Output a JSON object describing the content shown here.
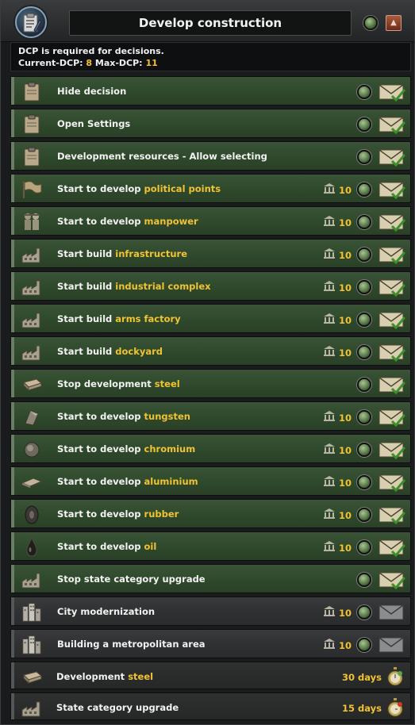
{
  "header": {
    "title": "Develop construction",
    "badge_icon": "decision-category-icon"
  },
  "info": {
    "line1": "DCP is required for decisions.",
    "current_label": "Current-DCP:",
    "current_value": "8",
    "max_label": "Max-DCP:",
    "max_value": "11"
  },
  "colors": {
    "highlight": "#f1c232",
    "row_green": "#2f4a2c",
    "row_gray": "#303132"
  },
  "rows": [
    {
      "prefix": "Hide decision",
      "highlight": "",
      "cost": "",
      "icon": "clipboard-icon",
      "style": "green",
      "state": "available"
    },
    {
      "prefix": "Open Settings",
      "highlight": "",
      "cost": "",
      "icon": "clipboard-icon",
      "style": "green",
      "state": "available"
    },
    {
      "prefix": "Development resources - Allow selecting",
      "highlight": "",
      "cost": "",
      "icon": "clipboard-icon",
      "style": "green",
      "state": "available"
    },
    {
      "prefix": "Start to develop ",
      "highlight": "political points",
      "cost": "10",
      "icon": "flag-icon",
      "style": "green",
      "state": "available"
    },
    {
      "prefix": "Start to develop ",
      "highlight": "manpower",
      "cost": "10",
      "icon": "soldiers-icon",
      "style": "green",
      "state": "available"
    },
    {
      "prefix": "Start build ",
      "highlight": "infrastructure",
      "cost": "10",
      "icon": "building-icon",
      "style": "green",
      "state": "available"
    },
    {
      "prefix": "Start build ",
      "highlight": "industrial complex",
      "cost": "10",
      "icon": "building-icon",
      "style": "green",
      "state": "available"
    },
    {
      "prefix": "Start build ",
      "highlight": "arms factory",
      "cost": "10",
      "icon": "building-icon",
      "style": "green",
      "state": "available"
    },
    {
      "prefix": "Start build ",
      "highlight": "dockyard",
      "cost": "10",
      "icon": "building-icon",
      "style": "green",
      "state": "available"
    },
    {
      "prefix": "Stop development ",
      "highlight": "steel",
      "cost": "",
      "icon": "steel-ingot-icon",
      "style": "green",
      "state": "available"
    },
    {
      "prefix": "Start to develop ",
      "highlight": "tungsten",
      "cost": "10",
      "icon": "tungsten-icon",
      "style": "green",
      "state": "available"
    },
    {
      "prefix": "Start to develop ",
      "highlight": "chromium",
      "cost": "10",
      "icon": "chromium-icon",
      "style": "green",
      "state": "available"
    },
    {
      "prefix": "Start to develop ",
      "highlight": "aluminium",
      "cost": "10",
      "icon": "aluminium-icon",
      "style": "green",
      "state": "available"
    },
    {
      "prefix": "Start to develop ",
      "highlight": "rubber",
      "cost": "10",
      "icon": "rubber-tire-icon",
      "style": "green",
      "state": "available"
    },
    {
      "prefix": "Start to develop ",
      "highlight": "oil",
      "cost": "10",
      "icon": "oil-drop-icon",
      "style": "green",
      "state": "available"
    },
    {
      "prefix": "Stop state category upgrade",
      "highlight": "",
      "cost": "",
      "icon": "building-icon",
      "style": "green",
      "state": "available"
    },
    {
      "prefix": "City modernization",
      "highlight": "",
      "cost": "10",
      "icon": "city-icon",
      "style": "gray",
      "state": "unavailable"
    },
    {
      "prefix": "Building a metropolitan area",
      "highlight": "",
      "cost": "10",
      "icon": "city-icon",
      "style": "gray",
      "state": "unavailable"
    }
  ],
  "missions": [
    {
      "prefix": "Development ",
      "highlight": "steel",
      "days": "30 days",
      "icon": "steel-ingot-icon",
      "timer": "stopwatch-green-icon"
    },
    {
      "prefix": "State category upgrade",
      "highlight": "",
      "days": "15 days",
      "icon": "building-icon",
      "timer": "stopwatch-red-icon"
    }
  ]
}
